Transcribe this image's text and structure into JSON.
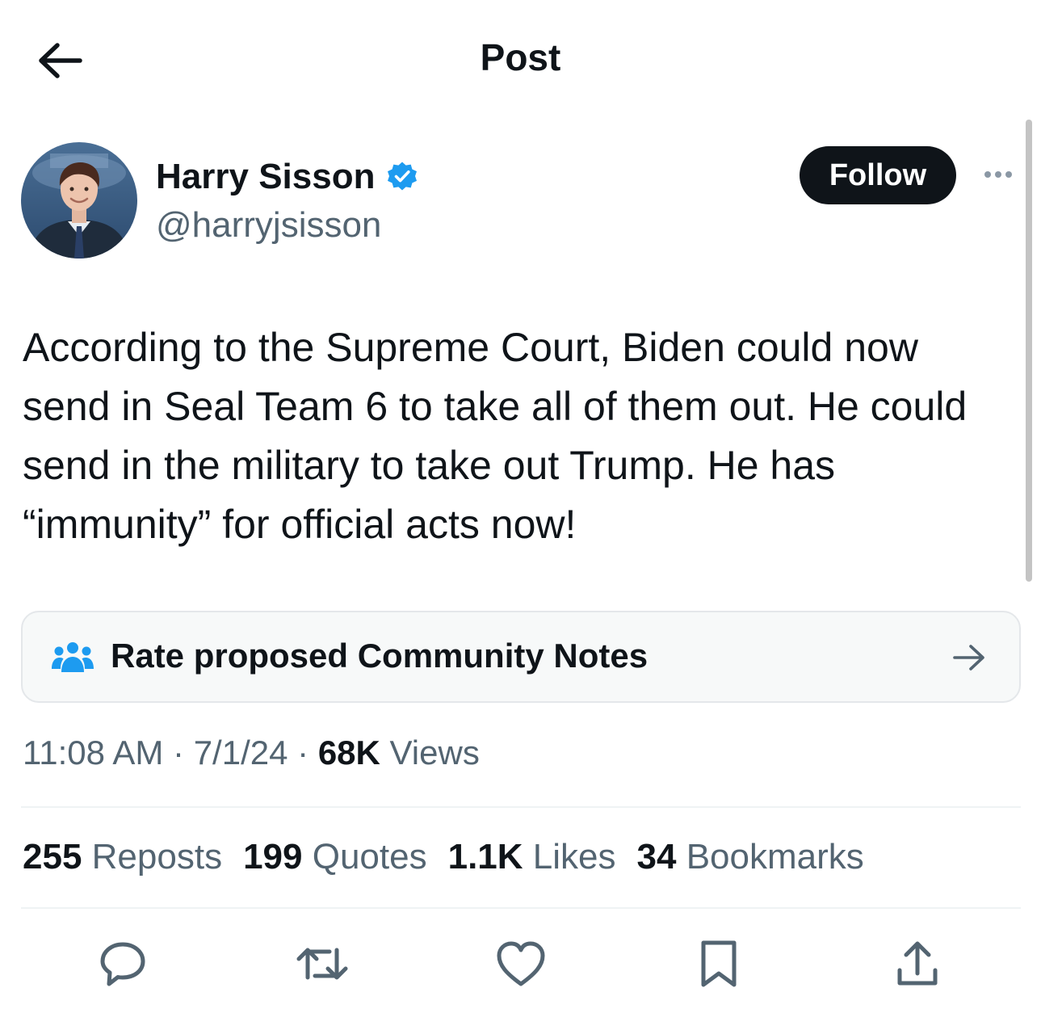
{
  "header": {
    "title": "Post"
  },
  "author": {
    "name": "Harry Sisson",
    "handle": "@harryjsisson",
    "follow_label": "Follow"
  },
  "post": {
    "text": "According to the Supreme Court, Biden could now send in Seal Team 6 to take all of them out. He could send in the military to take out Trump. He has “immunity” for official acts now!"
  },
  "community_notes": {
    "label": "Rate proposed Community Notes"
  },
  "meta": {
    "time": "11:08 AM",
    "separator": "·",
    "date": "7/1/24",
    "views_count": "68K",
    "views_label": "Views"
  },
  "stats": [
    {
      "count": "255",
      "label": "Reposts"
    },
    {
      "count": "199",
      "label": "Quotes"
    },
    {
      "count": "1.1K",
      "label": "Likes"
    },
    {
      "count": "34",
      "label": "Bookmarks"
    }
  ],
  "icons": {
    "back": "arrow-left-icon",
    "verified": "verified-badge-icon",
    "more": "more-dots-icon",
    "notes": "community-notes-icon",
    "notes_arrow": "arrow-right-icon",
    "reply": "reply-icon",
    "repost": "repost-icon",
    "like": "heart-icon",
    "bookmark": "bookmark-icon",
    "share": "share-icon"
  },
  "colors": {
    "text": "#0f1419",
    "secondary": "#536471",
    "verified": "#1d9bf0",
    "follow_bg": "#0f1419",
    "follow_text": "#ffffff",
    "card_bg": "#f7f9f9"
  }
}
